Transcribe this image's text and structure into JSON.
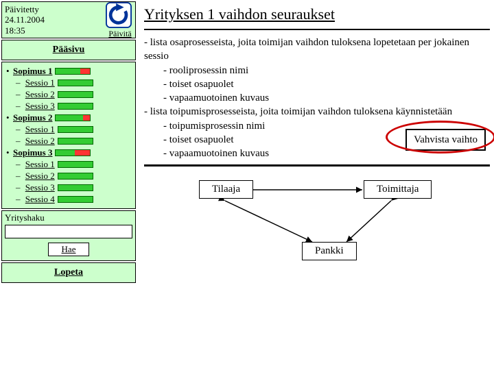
{
  "updated": {
    "label": "Päivitetty",
    "date": "24.11.2004",
    "time": "18:35",
    "refresh": "Päivitä"
  },
  "mainpage": "Pääsivu",
  "nav": {
    "s1": {
      "label": "Sopimus 1",
      "sessions": [
        "Sessio 1",
        "Sessio 2",
        "Sessio 3"
      ]
    },
    "s2": {
      "label": "Sopimus 2",
      "sessions": [
        "Sessio 1",
        "Sessio 2"
      ]
    },
    "s3": {
      "label": "Sopimus 3",
      "sessions": [
        "Sessio 1",
        "Sessio 2",
        "Sessio 3",
        "Sessio 4"
      ]
    }
  },
  "search": {
    "label": "Yrityshaku",
    "value": "",
    "button": "Hae"
  },
  "quit": "Lopeta",
  "main": {
    "title": "Yrityksen 1 vaihdon seuraukset",
    "lines": {
      "l1": "- lista osaprosesseista, joita toimijan vaihdon tuloksena lopetetaan per jokainen sessio",
      "l1a": "- rooliprosessin nimi",
      "l1b": "- toiset osapuolet",
      "l1c": "- vapaamuotoinen kuvaus",
      "l2": "- lista toipumisprosesseista, joita toimijan vaihdon tuloksena käynnistetään",
      "l2a": "- toipumisprosessin nimi",
      "l2b": "- toiset osapuolet",
      "l2c": "- vapaamuotoinen kuvaus"
    },
    "confirm": "Vahvista vaihto"
  },
  "diagram": {
    "tilaaja": "Tilaaja",
    "toimittaja": "Toimittaja",
    "pankki": "Pankki"
  }
}
